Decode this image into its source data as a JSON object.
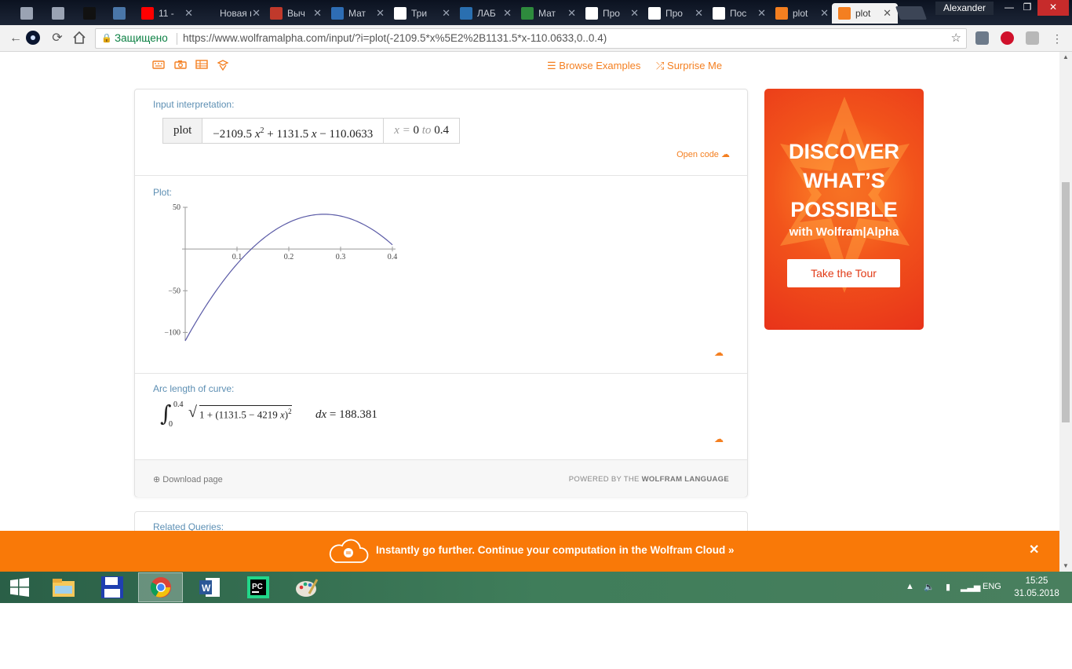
{
  "browser": {
    "tabs": [
      {
        "icon": "document-icon",
        "title": "",
        "color": "#9aa3b3"
      },
      {
        "icon": "document-icon",
        "title": "",
        "color": "#9aa3b3"
      },
      {
        "icon": "info-icon",
        "title": "",
        "color": "#111111"
      },
      {
        "icon": "vk-icon",
        "title": "",
        "color": "#4a76a8"
      },
      {
        "icon": "youtube-icon",
        "title": "11 -",
        "color": "#ff0000"
      },
      {
        "icon": "blank-icon",
        "title": "Новая в",
        "color": "#00000000"
      },
      {
        "icon": "library-icon",
        "title": "Выч",
        "color": "#c0392b"
      },
      {
        "icon": "s-logo-icon",
        "title": "Мат",
        "color": "#2e6db4"
      },
      {
        "icon": "dots-icon",
        "title": "Три",
        "color": "#ffffff"
      },
      {
        "icon": "s-blue-icon",
        "title": "ЛАБ",
        "color": "#2a6fb0"
      },
      {
        "icon": "green-diag-icon",
        "title": "Мат",
        "color": "#2e8b3d"
      },
      {
        "icon": "page-icon",
        "title": "Про",
        "color": "#ffffff"
      },
      {
        "icon": "page-icon",
        "title": "Про",
        "color": "#ffffff"
      },
      {
        "icon": "page-icon",
        "title": "Пос",
        "color": "#ffffff"
      },
      {
        "icon": "wolfram-icon",
        "title": "plot",
        "color": "#f47f20"
      },
      {
        "icon": "wolfram-icon",
        "title": "plot",
        "color": "#f47f20"
      }
    ],
    "close_glyph": "✕",
    "profile": "Alexander",
    "window_controls": {
      "minimize": "—",
      "restore": "❐",
      "close": "✕"
    },
    "secure_label": "Защищено",
    "url": "https://www.wolframalpha.com/input/?i=plot(-2109.5*x%5E2%2B1131.5*x-110.0633,0..0.4)"
  },
  "wa": {
    "browse_examples": "Browse Examples",
    "surprise_me": "Surprise Me",
    "input_interpretation": {
      "title": "Input interpretation:",
      "head": "plot",
      "expr_a": "−2109.5",
      "expr_var": "x",
      "expr_exp": "2",
      "expr_b": " + 1131.5 ",
      "expr_var2": "x",
      "expr_c": " − 110.0633",
      "range_var": "x",
      "range_eq": " = ",
      "range_from": "0",
      "range_to_word": " to ",
      "range_to": "0.4",
      "open_code": "Open code"
    },
    "plot": {
      "title": "Plot:"
    },
    "arc_length": {
      "title": "Arc length of curve:",
      "upper": "0.4",
      "lower": "0",
      "integrand_a": "1 + (1131.5 − 4219 ",
      "integrand_var": "x",
      "integrand_b": ")",
      "integrand_exp": "2",
      "dx_d": "d",
      "dx_var": "x",
      "result": " = 188.381"
    },
    "footer": {
      "download": "Download page",
      "powered_prefix": "POWERED BY THE ",
      "powered_brand": "WOLFRAM LANGUAGE"
    },
    "related_queries": "Related Queries:",
    "ad": {
      "line1": "DISCOVER",
      "line2": "WHAT’S",
      "line3": "POSSIBLE",
      "subline": "with Wolfram|Alpha",
      "button": "Take the Tour"
    },
    "cloud_bar": {
      "text": "Instantly go further. Continue your computation in the Wolfram Cloud »",
      "close": "✕"
    }
  },
  "chart_data": {
    "type": "line",
    "function": "-2109.5*x^2 + 1131.5*x - 110.0633",
    "x": [
      0,
      0.02,
      0.04,
      0.06,
      0.08,
      0.1,
      0.12,
      0.14,
      0.16,
      0.18,
      0.2,
      0.22,
      0.24,
      0.26,
      0.28,
      0.3,
      0.32,
      0.34,
      0.36,
      0.38,
      0.4
    ],
    "y": [
      -110.06,
      -88.27,
      -68.18,
      -49.77,
      -33.05,
      -18.02,
      -4.68,
      6.97,
      16.93,
      25.21,
      33.79,
      39.68,
      41.01,
      41.19,
      40.22,
      38.11,
      31.85,
      26.44,
      19.86,
      8.07,
      -4.31
    ],
    "xlim": [
      0,
      0.4
    ],
    "ylim": [
      -110,
      50
    ],
    "x_ticks": [
      "0.1",
      "0.2",
      "0.3",
      "0.4"
    ],
    "x_tick_values": [
      0.1,
      0.2,
      0.3,
      0.4
    ],
    "y_ticks": [
      "50",
      "−50",
      "−100"
    ],
    "y_tick_values": [
      50,
      -50,
      -100
    ],
    "line_color": "#5a5aa6",
    "grid": false
  },
  "taskbar": {
    "apps": [
      {
        "icon": "windows-start-icon"
      },
      {
        "icon": "file-explorer-icon"
      },
      {
        "icon": "floppy-disk-icon"
      },
      {
        "icon": "chrome-icon",
        "active": true
      },
      {
        "icon": "word-icon"
      },
      {
        "icon": "pycharm-icon"
      },
      {
        "icon": "paint-icon"
      }
    ],
    "language": "ENG",
    "time": "15:25",
    "date": "31.05.2018"
  },
  "colors": {
    "accent": "#f47f20",
    "pod_title": "#5d8fb3",
    "cloud_bar": "#f97908"
  }
}
